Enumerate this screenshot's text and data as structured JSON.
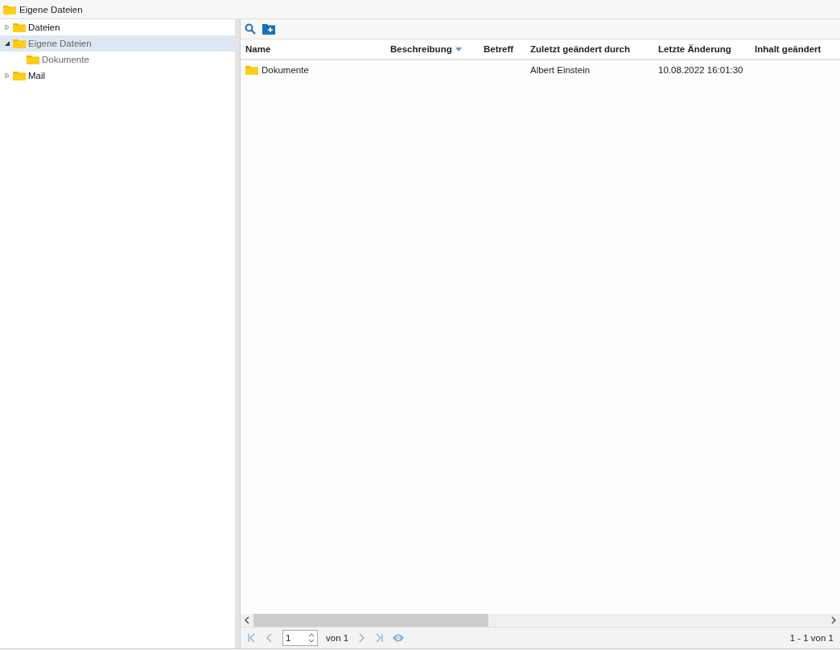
{
  "title": "Eigene Dateien",
  "tree": [
    {
      "label": "Dateien",
      "expanded": false,
      "selected": false
    },
    {
      "label": "Eigene Dateien",
      "expanded": true,
      "selected": true,
      "children": [
        {
          "label": "Dokumente",
          "selected": false
        }
      ]
    },
    {
      "label": "Mail",
      "expanded": false,
      "selected": false
    }
  ],
  "table": {
    "columns": [
      {
        "label": "Name",
        "sorted": false
      },
      {
        "label": "Beschreibung",
        "sorted": true
      },
      {
        "label": "Betreff",
        "sorted": false
      },
      {
        "label": "Zuletzt geändert durch",
        "sorted": false
      },
      {
        "label": "Letzte Änderung",
        "sorted": false
      },
      {
        "label": "Inhalt geändert",
        "sorted": false
      }
    ],
    "rows": [
      {
        "kind": "folder",
        "cells": [
          "Dokumente",
          "",
          "",
          "Albert Einstein",
          "10.08.2022 16:01:30",
          ""
        ]
      }
    ]
  },
  "pager": {
    "page": "1",
    "of": "von 1",
    "summary": "1 - 1 von 1"
  }
}
